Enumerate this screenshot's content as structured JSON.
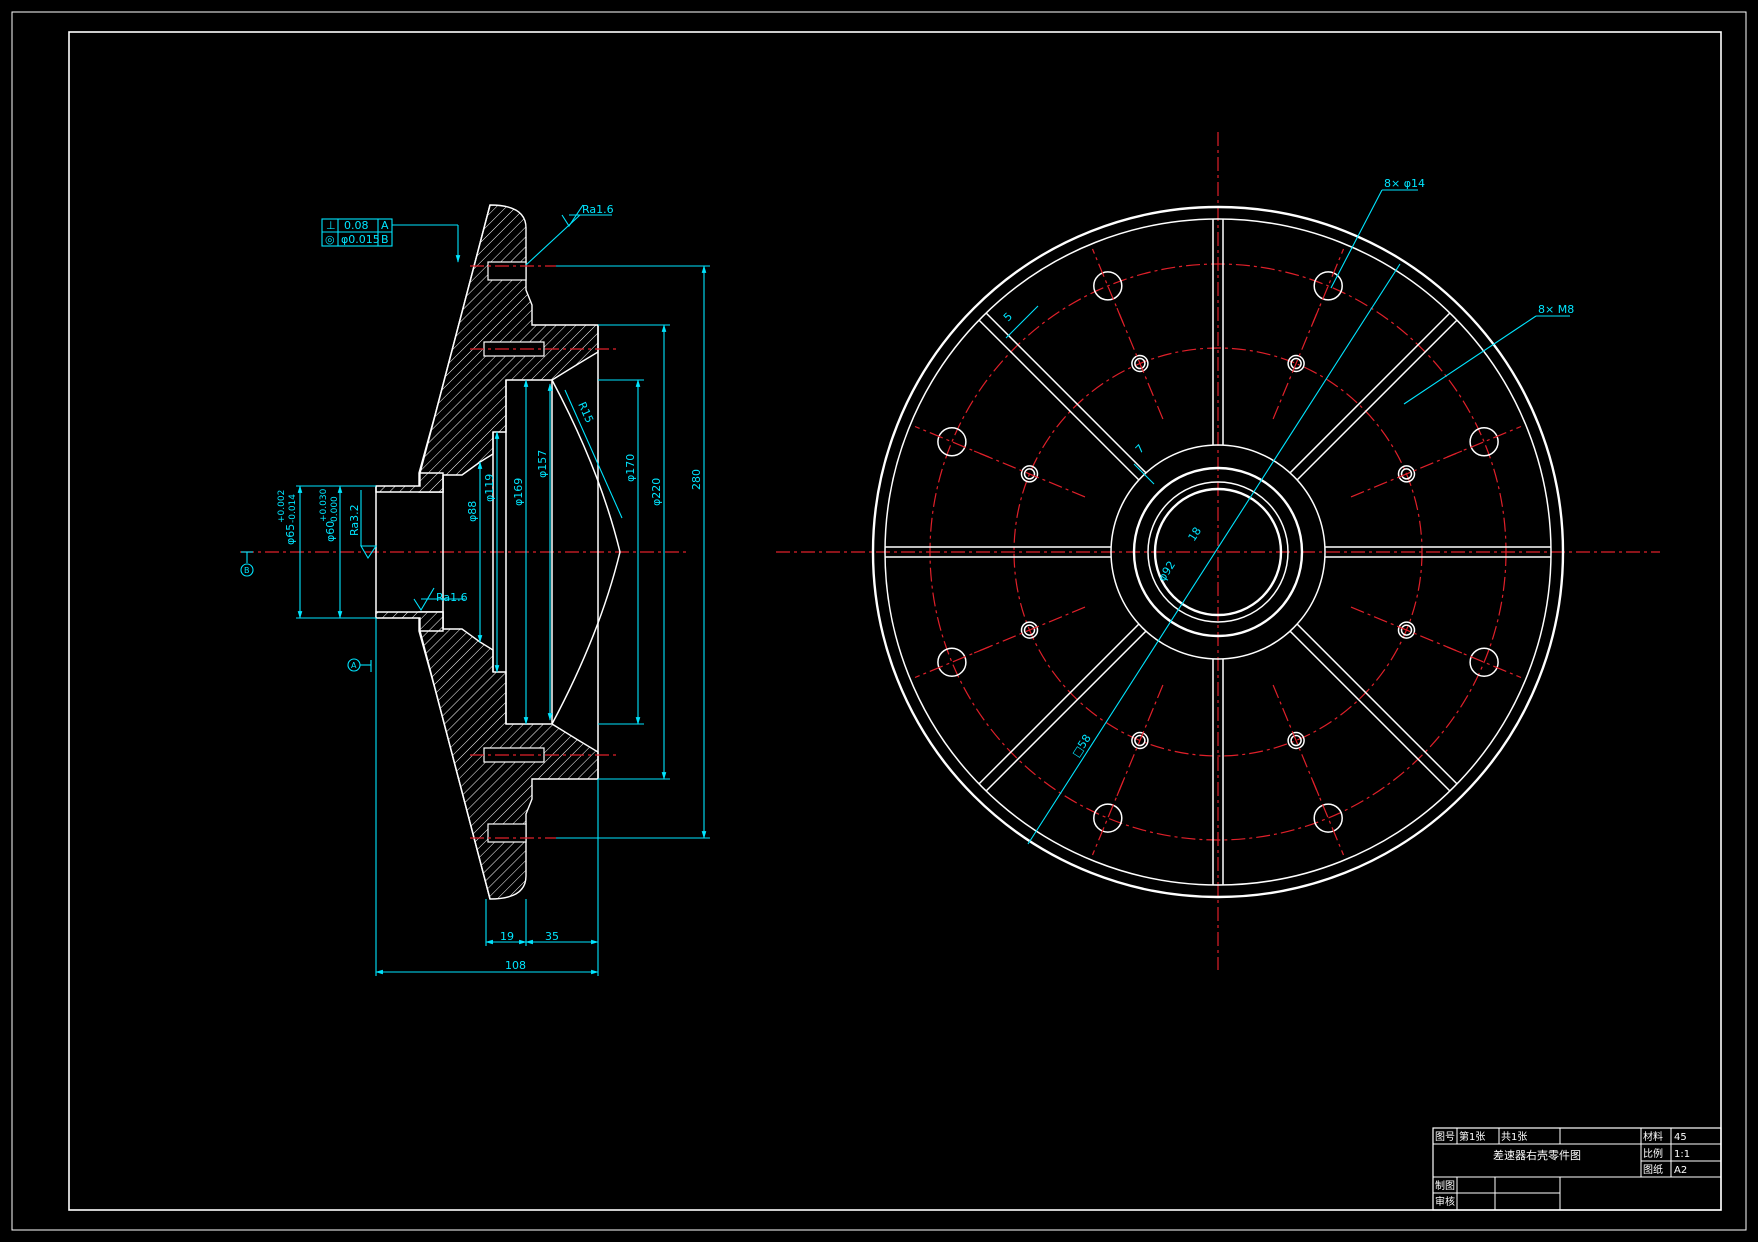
{
  "colors": {
    "background": "#000000",
    "outline": "#ffffff",
    "centerline": "#e0202a",
    "dimension": "#00e5ff"
  },
  "section_view": {
    "roughness": {
      "top": "Ra1.6",
      "middle": "Ra1.6",
      "bore": "Ra3.2"
    },
    "tolerance_frame": [
      {
        "symbol": "⊥",
        "value": "0.08",
        "datum": "A"
      },
      {
        "symbol": "◎",
        "value": "φ0.015",
        "datum": "B"
      }
    ],
    "datums": {
      "a": "A",
      "b": "B"
    },
    "dims": {
      "d65": "φ65",
      "d65_tol_up": "+0.002",
      "d65_tol_lo": "-0.014",
      "d60": "φ60",
      "d60_tol_up": "+0.030",
      "d60_tol_lo": "0.000",
      "d88": "φ88",
      "d119": "φ119",
      "d169": "φ169",
      "d157": "φ157",
      "d170": "φ170",
      "d220": "φ220",
      "d280": "280",
      "r15": "R15",
      "w19": "19",
      "w35": "35",
      "w108": "108"
    }
  },
  "end_view": {
    "callouts": {
      "holes_big": "8× φ14",
      "holes_thread": "8× M8",
      "rib": "5",
      "slot": "7",
      "key1": "18",
      "key2": "φ92",
      "key3": "□58"
    }
  },
  "title_block": {
    "drawing_no_label": "图号",
    "sheet_label": "第1张",
    "total_label": "共1张",
    "title": "差速器右壳零件图",
    "material_label": "材料",
    "material_value": "45",
    "scale_label": "比例",
    "scale_value": "1:1",
    "paper_label": "图纸",
    "paper_value": "A2",
    "drawn_label": "制图",
    "check_label": "审核"
  }
}
